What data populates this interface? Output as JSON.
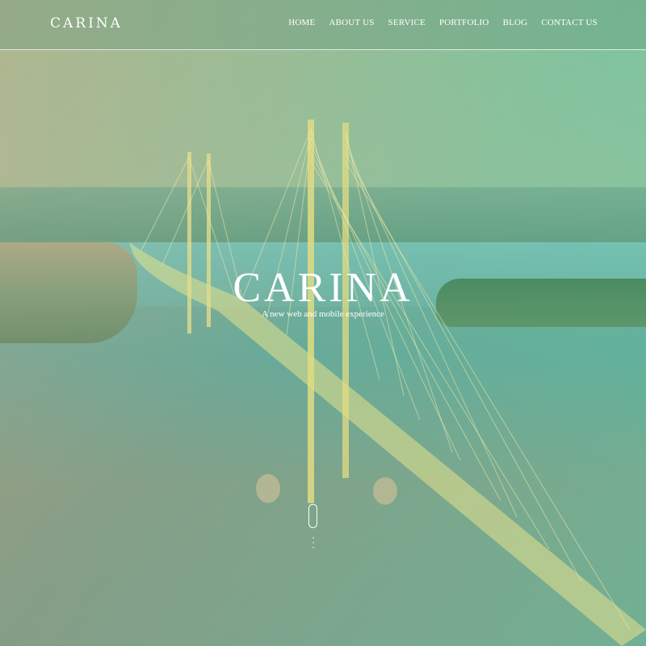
{
  "brand": {
    "logo_text": "CARINA"
  },
  "nav": {
    "items": [
      {
        "label": "HOME"
      },
      {
        "label": "ABOUT US"
      },
      {
        "label": "SERVICE"
      },
      {
        "label": "PORTFOLIO"
      },
      {
        "label": "BLOG"
      },
      {
        "label": "CONTACT US"
      }
    ]
  },
  "hero": {
    "title": "CARINA",
    "subtitle": "A new web and mobile experience",
    "background": "cable-stayed-bridge-over-river-photo",
    "scroll_icon": "mouse-scroll-icon",
    "scroll_chevrons": "˅\n˅\n˅"
  },
  "colors": {
    "overlay_start": "#d6a880",
    "overlay_end": "#5ccda5",
    "text": "#ffffff"
  }
}
